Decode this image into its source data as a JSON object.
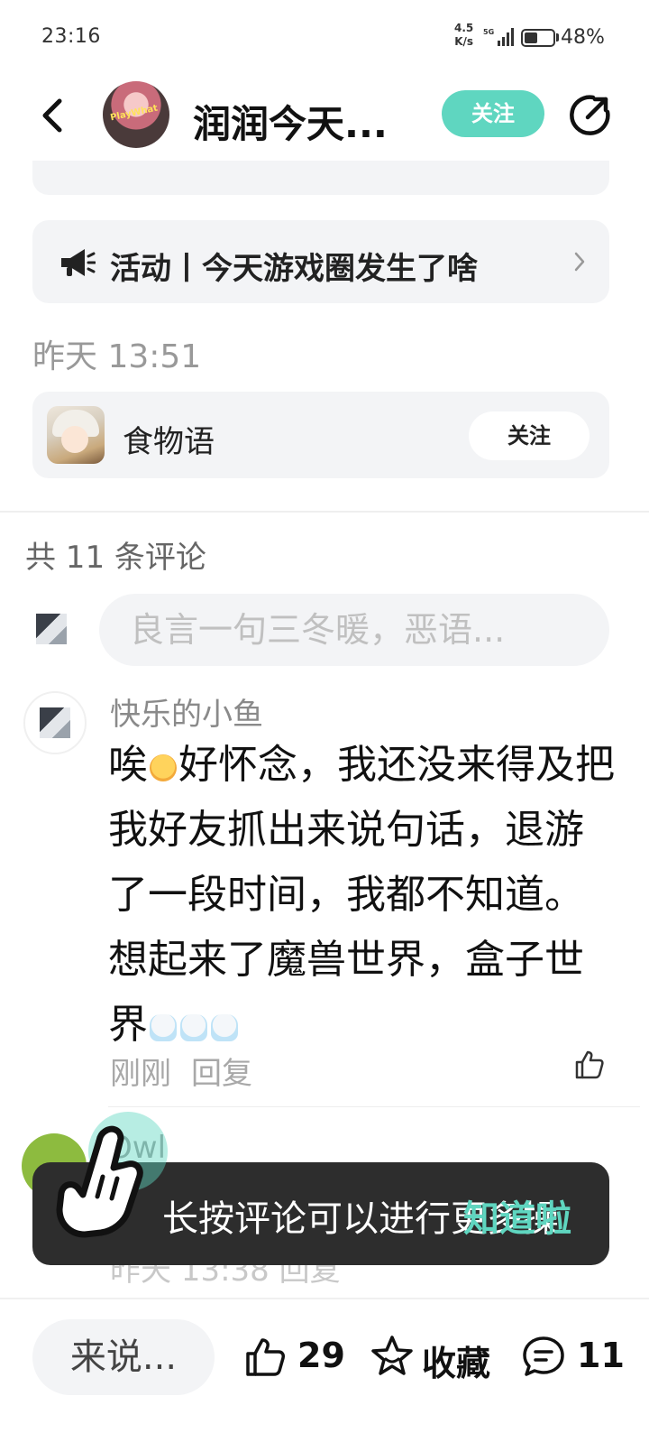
{
  "status_bar": {
    "time": "23:16",
    "net_speed_value": "4.5",
    "net_speed_unit": "K/s",
    "battery_percent": "48%",
    "battery_level": 0.48
  },
  "header": {
    "title": "润润今天...",
    "follow_label": "关注",
    "accent_color": "#5fd6c0"
  },
  "activity": {
    "label": "活动丨今天游戏圈发生了啥"
  },
  "post_time": "昨天 13:51",
  "game_card": {
    "name": "食物语",
    "follow_label": "关注"
  },
  "comments_section": {
    "count_label": "共 11 条评论",
    "input_placeholder": "良言一句三冬暖，恶语..."
  },
  "comments": [
    {
      "author": "快乐的小鱼",
      "text_parts": [
        "唉",
        "好怀念，我还没来得及把我好友抓出来说句话，退游了一段时间，我都不知道。想起来了魔兽世界，盒子世界"
      ],
      "time": "刚刚",
      "reply_label": "回复"
    },
    {
      "author": "Owl",
      "time": "昨天 13:38",
      "reply_label": "回复"
    }
  ],
  "toast": {
    "message": "长按评论可以进行更多操",
    "action_label": "知道啦"
  },
  "bottom_bar": {
    "input_label": "来说...",
    "like_count": "29",
    "favorite_label": "收藏",
    "comment_count": "11"
  },
  "icons": {
    "back": "chevron-left-icon",
    "share": "share-icon",
    "activity": "megaphone-icon",
    "like": "thumb-up-icon",
    "favorite": "star-icon",
    "comment": "comment-bubble-icon"
  }
}
